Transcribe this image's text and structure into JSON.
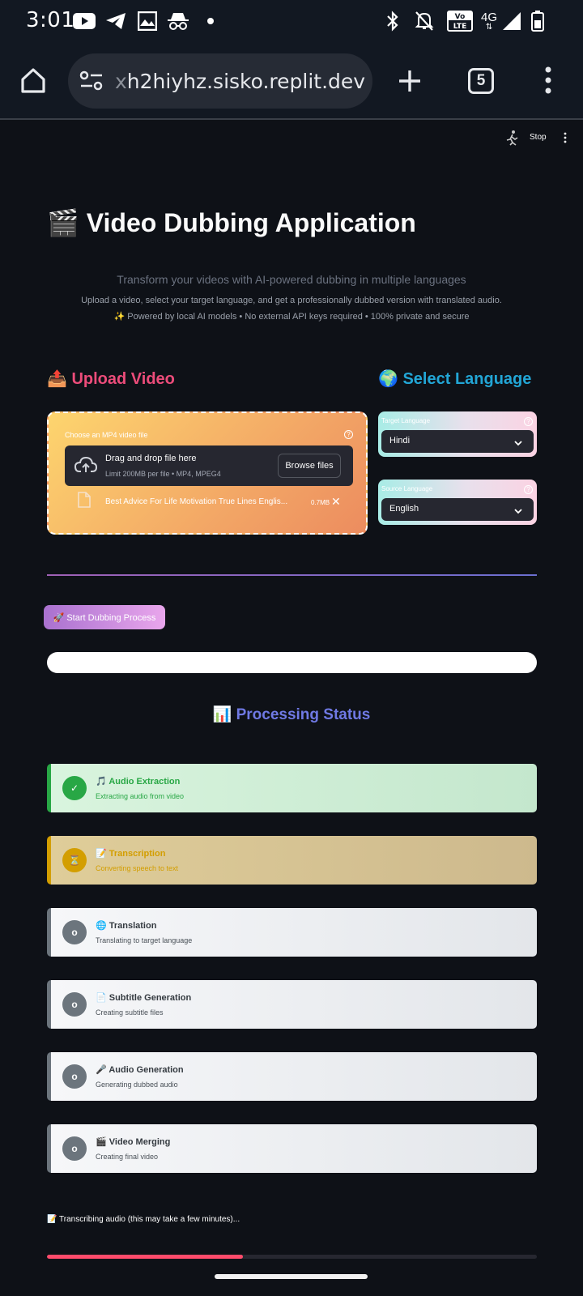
{
  "status_bar": {
    "time": "3:01",
    "icons": [
      "youtube-icon",
      "telegram-icon",
      "gallery-icon",
      "incognito-icon",
      "dot-icon",
      "bluetooth-icon",
      "mute-bell-icon",
      "volte-icon",
      "4g-icon",
      "signal-icon",
      "battery-icon"
    ],
    "volte_label": "Vo\nLTE",
    "network_label": "4G"
  },
  "browser": {
    "url_dim": "x",
    "url_main": "h2hiyhz.sisko.replit.dev",
    "tab_count": "5"
  },
  "toolbar": {
    "stop_label": "Stop"
  },
  "header": {
    "title": "🎬 Video Dubbing Application",
    "subtitle": "Transform your videos with AI-powered dubbing in multiple languages",
    "description": "Upload a video, select your target language, and get a professionally dubbed version with translated audio.",
    "powered": "✨ Powered by local AI models • No external API keys required • 100% private and secure"
  },
  "upload": {
    "heading": "📤 Upload Video",
    "label": "Choose an MP4 video file",
    "drop_title": "Drag and drop file here",
    "drop_limit": "Limit 200MB per file • MP4, MPEG4",
    "browse_label": "Browse files",
    "file_name": "Best Advice For Life Motivation True Lines Englis...",
    "file_size": "0.7MB"
  },
  "language": {
    "heading": "🌍 Select Language",
    "target_label": "Target Language",
    "target_value": "Hindi",
    "source_label": "Source Language",
    "source_value": "English"
  },
  "actions": {
    "start_label": "🚀 Start Dubbing Process"
  },
  "processing": {
    "heading": "📊 Processing Status",
    "steps": [
      {
        "title": "🎵 Audio Extraction",
        "desc": "Extracting audio from video",
        "state": "done",
        "symbol": "✓"
      },
      {
        "title": "📝 Transcription",
        "desc": "Converting speech to text",
        "state": "active",
        "symbol": "⏳"
      },
      {
        "title": "🌐 Translation",
        "desc": "Translating to target language",
        "state": "pending",
        "symbol": "o"
      },
      {
        "title": "📄 Subtitle Generation",
        "desc": "Creating subtitle files",
        "state": "pending",
        "symbol": "o"
      },
      {
        "title": "🎤 Audio Generation",
        "desc": "Generating dubbed audio",
        "state": "pending",
        "symbol": "o"
      },
      {
        "title": "🎬 Video Merging",
        "desc": "Creating final video",
        "state": "pending",
        "symbol": "o"
      }
    ],
    "status_text": "📝 Transcribing audio (this may take a few minutes)...",
    "progress": 0.4
  },
  "colors": {
    "done": "#28a745",
    "active": "#d39e00",
    "pending": "#6c757d",
    "progress": "#ff4b6b"
  }
}
